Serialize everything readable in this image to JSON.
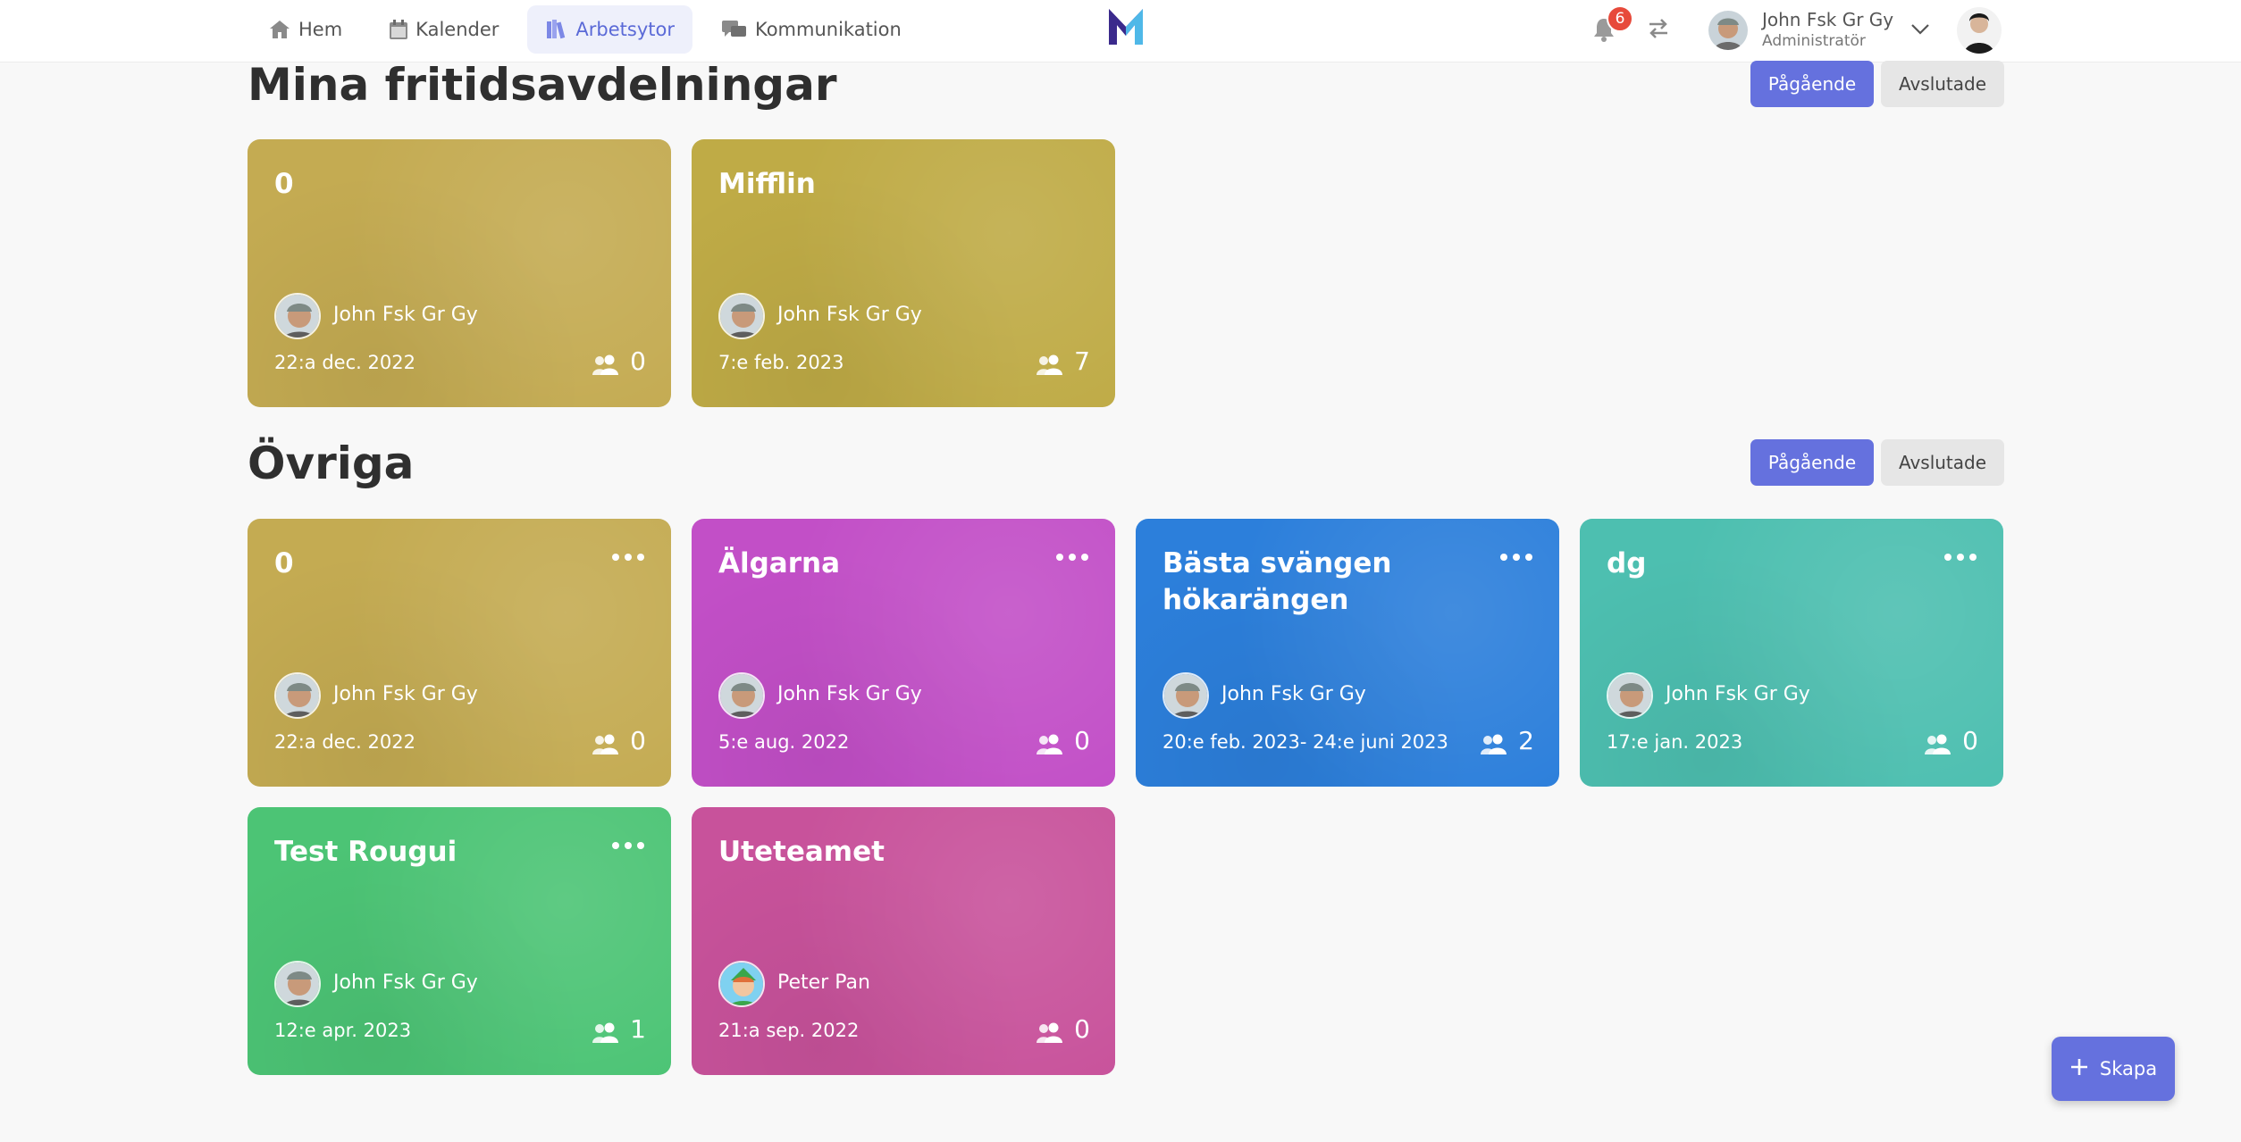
{
  "nav": {
    "items": [
      {
        "label": "Hem",
        "icon": "home-icon"
      },
      {
        "label": "Kalender",
        "icon": "calendar-icon"
      },
      {
        "label": "Arbetsytor",
        "icon": "books-icon",
        "active": true
      },
      {
        "label": "Kommunikation",
        "icon": "chat-icon"
      }
    ]
  },
  "header": {
    "notification_count": "6",
    "user_name": "John Fsk Gr Gy",
    "user_role": "Administratör"
  },
  "colors": {
    "accent": "#6571de",
    "ochre": "#c4ab52",
    "olive_gold": "#bfab46",
    "magenta": "#c24fc7",
    "blue": "#2c7fdb",
    "teal": "#4dbfb0",
    "green": "#4cc475",
    "pink": "#c8529b"
  },
  "sections": {
    "mine": {
      "title": "Mina fritidsavdelningar",
      "ongoing": "Pågående",
      "finished": "Avslutade",
      "cards": [
        {
          "title": "0",
          "owner": "John Fsk Gr Gy",
          "date": "22:a dec. 2022",
          "members": "0",
          "color": "#c4ab52"
        },
        {
          "title": "Mifflin",
          "owner": "John Fsk Gr Gy",
          "date": "7:e feb. 2023",
          "members": "7",
          "color": "#bfab46"
        }
      ]
    },
    "other": {
      "title": "Övriga",
      "ongoing": "Pågående",
      "finished": "Avslutade",
      "cards": [
        {
          "title": "0",
          "owner": "John Fsk Gr Gy",
          "date": "22:a dec. 2022",
          "members": "0",
          "color": "#c4ab52"
        },
        {
          "title": "Älgarna",
          "owner": "John Fsk Gr Gy",
          "date": "5:e aug. 2022",
          "members": "0",
          "color": "#c24fc7"
        },
        {
          "title": "Bästa svängen hökarängen",
          "owner": "John Fsk Gr Gy",
          "date": "20:e feb. 2023- 24:e juni 2023",
          "members": "2",
          "color": "#2c7fdb"
        },
        {
          "title": "dg",
          "owner": "John Fsk Gr Gy",
          "date": "17:e jan. 2023",
          "members": "0",
          "color": "#4dbfb0"
        },
        {
          "title": "Test Rougui",
          "owner": "John Fsk Gr Gy",
          "date": "12:e apr. 2023",
          "members": "1",
          "color": "#4cc475"
        },
        {
          "title": "Uteteamet",
          "owner": "Peter Pan",
          "date": "21:a sep. 2022",
          "members": "0",
          "color": "#c8529b"
        }
      ]
    }
  },
  "fab": {
    "label": "Skapa"
  }
}
